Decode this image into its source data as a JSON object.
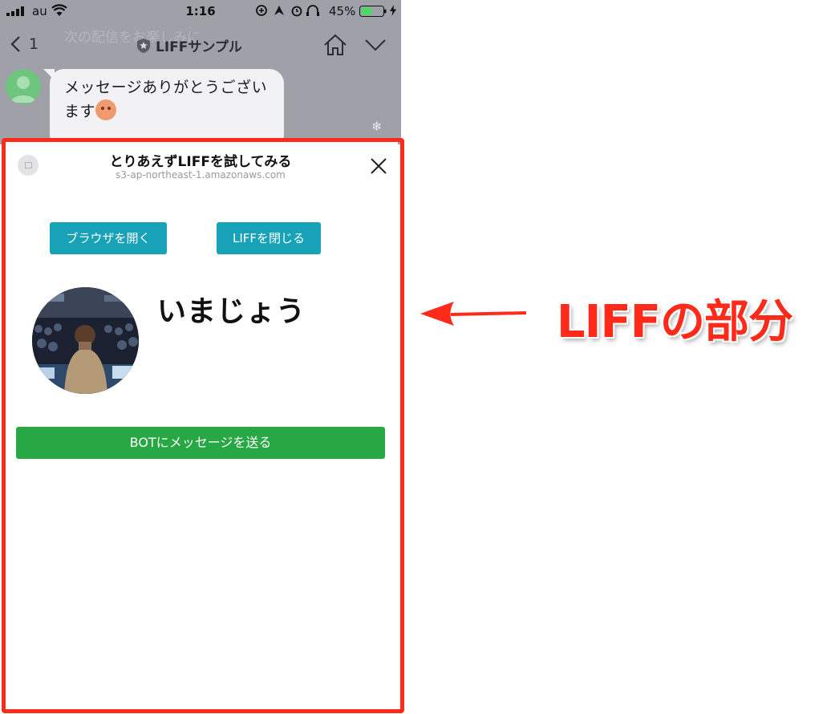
{
  "status_bar": {
    "carrier": "au",
    "time": "1:16",
    "battery_percent": "45%"
  },
  "nav": {
    "back_count": "1",
    "title": "LIFFサンプル",
    "ghost_text": "次の配信をお楽しみに"
  },
  "chat": {
    "message_line1": "メッセージありがとうござい",
    "message_line2": "ます"
  },
  "liff": {
    "title": "とりあえずLIFFを試してみる",
    "url": "s3-ap-northeast-1.amazonaws.com",
    "open_browser_label": "ブラウザを開く",
    "close_liff_label": "LIFFを閉じる",
    "profile_name": "いまじょう",
    "send_message_label": "BOTにメッセージを送る"
  },
  "annotation": {
    "label": "LIFFの部分",
    "color": "#ff2a1a"
  },
  "colors": {
    "blue_button": "#17a2b8",
    "green_button": "#28a745"
  }
}
